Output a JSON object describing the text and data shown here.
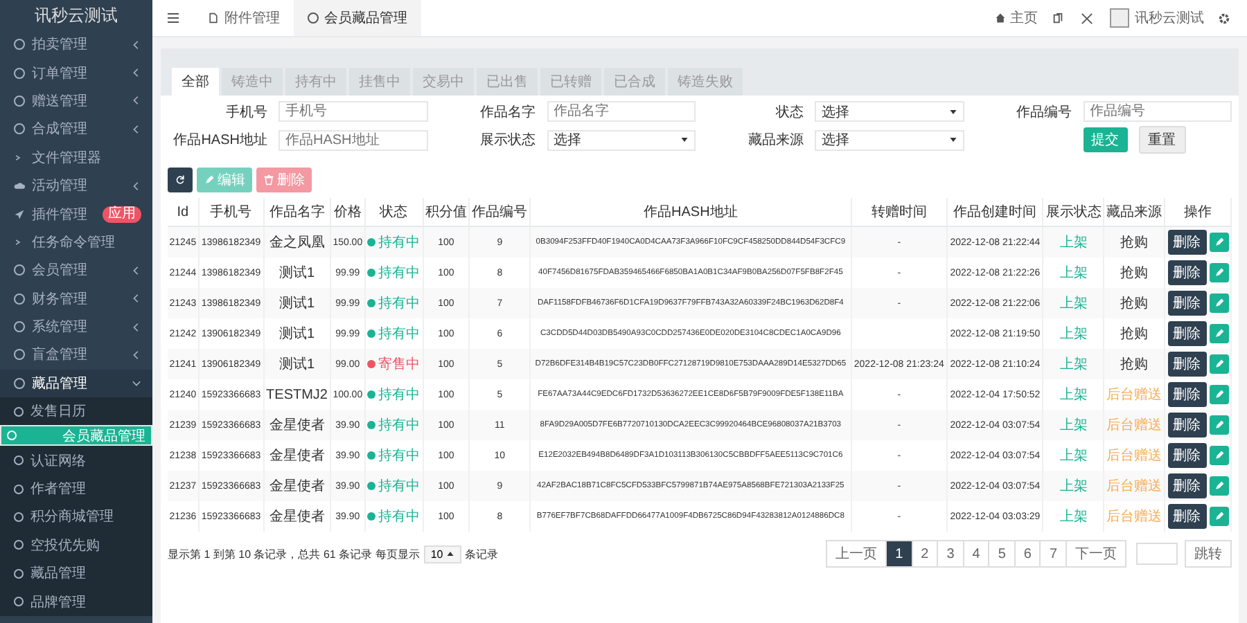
{
  "sidebar": {
    "title": "讯秒云测试",
    "items": [
      {
        "label": "拍卖管理",
        "kind": "group",
        "expanded": false
      },
      {
        "label": "订单管理",
        "kind": "group",
        "expanded": false
      },
      {
        "label": "赠送管理",
        "kind": "group",
        "expanded": false
      },
      {
        "label": "合成管理",
        "kind": "group",
        "expanded": false
      },
      {
        "label": "文件管理器",
        "kind": "page"
      },
      {
        "label": "活动管理",
        "kind": "activity",
        "expanded": false
      },
      {
        "label": "插件管理",
        "kind": "plugin",
        "badge": "应用"
      },
      {
        "label": "任务命令管理",
        "kind": "page"
      },
      {
        "label": "会员管理",
        "kind": "group",
        "expanded": false
      },
      {
        "label": "财务管理",
        "kind": "group",
        "expanded": false
      },
      {
        "label": "系统管理",
        "kind": "group",
        "expanded": false
      },
      {
        "label": "盲盒管理",
        "kind": "group",
        "expanded": false
      },
      {
        "label": "藏品管理",
        "kind": "group",
        "expanded": true,
        "children": [
          {
            "label": "发售日历",
            "selected": false
          },
          {
            "label": "会员藏品管理",
            "selected": true
          },
          {
            "label": "认证网络",
            "selected": false
          },
          {
            "label": "作者管理",
            "selected": false
          },
          {
            "label": "积分商城管理",
            "selected": false
          },
          {
            "label": "空投优先购",
            "selected": false
          },
          {
            "label": "藏品管理",
            "selected": false
          },
          {
            "label": "品牌管理",
            "selected": false
          }
        ]
      }
    ]
  },
  "topbar": {
    "page_tabs": [
      {
        "label": "附件管理",
        "kind": "file",
        "selected": false
      },
      {
        "label": "会员藏品管理",
        "kind": "module",
        "selected": true
      }
    ],
    "home": "主页",
    "user": "讯秒云测试"
  },
  "status_tabs": [
    {
      "label": "全部",
      "selected": true
    },
    {
      "label": "铸造中",
      "selected": false
    },
    {
      "label": "持有中",
      "selected": false
    },
    {
      "label": "挂售中",
      "selected": false
    },
    {
      "label": "交易中",
      "selected": false
    },
    {
      "label": "已出售",
      "selected": false
    },
    {
      "label": "已转赠",
      "selected": false
    },
    {
      "label": "已合成",
      "selected": false
    },
    {
      "label": "铸造失败",
      "selected": false
    }
  ],
  "filters": [
    {
      "label": "手机号",
      "kind": "text",
      "placeholder": "手机号"
    },
    {
      "label": "作品名字",
      "kind": "text",
      "placeholder": "作品名字"
    },
    {
      "label": "状态",
      "kind": "select",
      "value": "选择"
    },
    {
      "label": "作品编号",
      "kind": "text",
      "placeholder": "作品编号"
    },
    {
      "label": "作品HASH地址",
      "kind": "text",
      "placeholder": "作品HASH地址"
    },
    {
      "label": "展示状态",
      "kind": "select",
      "value": "选择"
    },
    {
      "label": "藏品来源",
      "kind": "select",
      "value": "选择"
    }
  ],
  "filter_buttons": [
    "提交",
    "重置"
  ],
  "toolbar": [
    {
      "kind": "refresh",
      "disabled": false
    },
    {
      "kind": "edit",
      "label": "编辑",
      "disabled": true
    },
    {
      "kind": "delete",
      "label": "删除",
      "disabled": true
    }
  ],
  "table": {
    "columns": [
      "Id",
      "手机号",
      "作品名字",
      "价格",
      "状态",
      "积分值",
      "作品编号",
      "作品HASH地址",
      "转赠时间",
      "作品创建时间",
      "展示状态",
      "藏品来源",
      "操作"
    ],
    "rows": [
      {
        "id": "21245",
        "phone": "13986182349",
        "name": "金之凤凰",
        "price": "150.00",
        "status": {
          "text": "持有中",
          "color": "#1ab394"
        },
        "points": "100",
        "number": "9",
        "hash": "0B3094F253FFD40F1940CA0D4CAA73F3A966F10FC9CF458250DD844D54F3CFC9",
        "transfer_time": "-",
        "created": "2022-12-08 21:22:44",
        "display": "上架",
        "source": {
          "text": "抢购",
          "color": "#333333"
        },
        "action": "删除"
      },
      {
        "id": "21244",
        "phone": "13986182349",
        "name": "测试1",
        "price": "99.99",
        "status": {
          "text": "持有中",
          "color": "#1ab394"
        },
        "points": "100",
        "number": "8",
        "hash": "40F7456D81675FDAB359465466F6850BA1A0B1C34AF9B0BA256D07F5FB8F2F45",
        "transfer_time": "-",
        "created": "2022-12-08 21:22:26",
        "display": "上架",
        "source": {
          "text": "抢购",
          "color": "#333333"
        },
        "action": "删除"
      },
      {
        "id": "21243",
        "phone": "13986182349",
        "name": "测试1",
        "price": "99.99",
        "status": {
          "text": "持有中",
          "color": "#1ab394"
        },
        "points": "100",
        "number": "7",
        "hash": "DAF1158FDFB46736F6D1CFA19D9637F79FFB743A32A60339F24BC1963D62D8F4",
        "transfer_time": "-",
        "created": "2022-12-08 21:22:06",
        "display": "上架",
        "source": {
          "text": "抢购",
          "color": "#333333"
        },
        "action": "删除"
      },
      {
        "id": "21242",
        "phone": "13906182349",
        "name": "测试1",
        "price": "99.99",
        "status": {
          "text": "持有中",
          "color": "#1ab394"
        },
        "points": "100",
        "number": "6",
        "hash": "C3CDD5D44D03DB5490A93C0CDD257436E0DE020DE3104C8CDEC1A0CA9D96",
        "created": "2022-12-08 21:19:50",
        "display": "上架",
        "source": {
          "text": "抢购",
          "color": "#333333"
        },
        "action": "删除"
      },
      {
        "id": "21241",
        "phone": "13906182349",
        "name": "测试1",
        "price": "99.00",
        "status": {
          "text": "寄售中",
          "color": "#ed5565"
        },
        "points": "100",
        "number": "5",
        "hash": "D72B6DFE314B4B19C57C23DB0FFC27128719D9810E753DAAA289D14E5327DD65",
        "transfer_time": "2022-12-08 21:23:24",
        "created": "2022-12-08 21:10:24",
        "display": "上架",
        "source": {
          "text": "抢购",
          "color": "#333333"
        },
        "action": "删除"
      },
      {
        "id": "21240",
        "phone": "15923366683",
        "name": "TESTMJ2",
        "price": "100.00",
        "status": {
          "text": "持有中",
          "color": "#1ab394"
        },
        "points": "100",
        "number": "5",
        "hash": "FE67AA73A44C9EDC6FD1732D53636272EE1CE8D6F5B79F9009FDE5F138E11BA",
        "transfer_time": "-",
        "created": "2022-12-04 17:50:52",
        "display": "上架",
        "source": {
          "text": "后台赠送",
          "color": "#f8ac59"
        },
        "action": "删除"
      },
      {
        "id": "21239",
        "phone": "15923366683",
        "name": "金星使者",
        "price": "39.90",
        "status": {
          "text": "持有中",
          "color": "#1ab394"
        },
        "points": "100",
        "number": "11",
        "hash": "8FA9D29A005D7FE6B7720710130DCA2EEC3C99920464BCE96808037A21B3703",
        "transfer_time": "-",
        "created": "2022-12-04 03:07:54",
        "display": "上架",
        "source": {
          "text": "后台赠送",
          "color": "#f8ac59"
        },
        "action": "删除"
      },
      {
        "id": "21238",
        "phone": "15923366683",
        "name": "金星使者",
        "price": "39.90",
        "status": {
          "text": "持有中",
          "color": "#1ab394"
        },
        "points": "100",
        "number": "10",
        "hash": "E12E2032EB494B8D6489DF3A1D103113B306130C5CBBDFF5AEE5113C9C701C6",
        "transfer_time": "-",
        "created": "2022-12-04 03:07:54",
        "display": "上架",
        "source": {
          "text": "后台赠送",
          "color": "#f8ac59"
        },
        "action": "删除"
      },
      {
        "id": "21237",
        "phone": "15923366683",
        "name": "金星使者",
        "price": "39.90",
        "status": {
          "text": "持有中",
          "color": "#1ab394"
        },
        "points": "100",
        "number": "9",
        "hash": "42AF2BAC18B71C8FC5CFD533BFC5799871B74AE975A8568BFE721303A2133F25",
        "transfer_time": "-",
        "created": "2022-12-04 03:07:54",
        "display": "上架",
        "source": {
          "text": "后台赠送",
          "color": "#f8ac59"
        },
        "action": "删除"
      },
      {
        "id": "21236",
        "phone": "15923366683",
        "name": "金星使者",
        "price": "39.90",
        "status": {
          "text": "持有中",
          "color": "#1ab394"
        },
        "points": "100",
        "number": "8",
        "hash": "B776EF7BF7CB68DAFFDD66477A1009F4DB6725C86D94F43283812A0124886DC8",
        "transfer_time": "-",
        "created": "2022-12-04 03:03:29",
        "display": "上架",
        "source": {
          "text": "后台赠送",
          "color": "#f8ac59"
        },
        "action": "删除"
      }
    ]
  },
  "pagination": {
    "summary": "显示第 1 到第 10 条记录，总共 61 条记录 每页显示",
    "page_size": "10",
    "suffix": "条记录",
    "prev": "上一页",
    "pages": [
      {
        "label": "1",
        "selected": true
      },
      {
        "label": "2",
        "selected": false
      },
      {
        "label": "3",
        "selected": false
      },
      {
        "label": "4",
        "selected": false
      },
      {
        "label": "5",
        "selected": false
      },
      {
        "label": "6",
        "selected": false
      },
      {
        "label": "7",
        "selected": false
      }
    ],
    "next": "下一页",
    "jump": "跳转"
  }
}
